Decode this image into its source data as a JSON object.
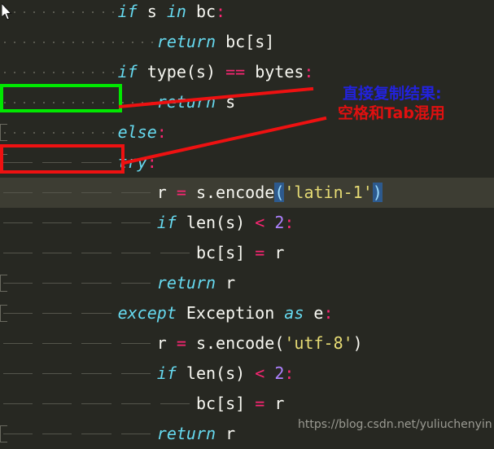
{
  "editor": {
    "background": "#272822",
    "current_line_background": "#3d3d33",
    "language": "python",
    "font_size_px": 20,
    "line_height_px": 37,
    "lines": [
      {
        "n": 1,
        "indent_kind": "spaces",
        "indent_units": 12,
        "text": "            if s in bc:",
        "tokens": [
          {
            "t": "if",
            "c": "kw"
          },
          {
            "t": " s ",
            "c": "id"
          },
          {
            "t": "in",
            "c": "kw"
          },
          {
            "t": " bc",
            "c": "id"
          },
          {
            "t": ":",
            "c": "op"
          }
        ]
      },
      {
        "n": 2,
        "indent_kind": "spaces",
        "indent_units": 16,
        "text": "                return bc[s]",
        "tokens": [
          {
            "t": "return",
            "c": "kw"
          },
          {
            "t": " bc[s]",
            "c": "id"
          }
        ]
      },
      {
        "n": 3,
        "indent_kind": "spaces",
        "indent_units": 12,
        "text": "            if type(s) == bytes:",
        "tokens": [
          {
            "t": "if",
            "c": "kw"
          },
          {
            "t": " type(s) ",
            "c": "id"
          },
          {
            "t": "==",
            "c": "op"
          },
          {
            "t": " bytes",
            "c": "id"
          },
          {
            "t": ":",
            "c": "op"
          }
        ]
      },
      {
        "n": 4,
        "indent_kind": "spaces",
        "indent_units": 16,
        "text": "                return s",
        "tokens": [
          {
            "t": "return",
            "c": "kw"
          },
          {
            "t": " s",
            "c": "id"
          }
        ]
      },
      {
        "n": 5,
        "indent_kind": "spaces",
        "indent_units": 12,
        "text": "            else:",
        "tokens": [
          {
            "t": "else",
            "c": "kw"
          },
          {
            "t": ":",
            "c": "op"
          }
        ]
      },
      {
        "n": 6,
        "indent_kind": "tabs",
        "indent_units": 3,
        "text": "\t\t\ttry:",
        "tokens": [
          {
            "t": "try",
            "c": "kw"
          },
          {
            "t": ":",
            "c": "op"
          }
        ]
      },
      {
        "n": 7,
        "indent_kind": "tabs",
        "indent_units": 4,
        "current": true,
        "text": "\t\t\t\tr = s.encode('latin-1')",
        "tokens": [
          {
            "t": "r ",
            "c": "id"
          },
          {
            "t": "=",
            "c": "op"
          },
          {
            "t": " s.encode",
            "c": "id"
          },
          {
            "t": "(",
            "c": "brkhl"
          },
          {
            "t": "'latin-1'",
            "c": "str"
          },
          {
            "t": ")",
            "c": "brkhl"
          }
        ]
      },
      {
        "n": 8,
        "indent_kind": "tabs",
        "indent_units": 4,
        "text": "\t\t\t\tif len(s) < 2:",
        "tokens": [
          {
            "t": "if",
            "c": "kw"
          },
          {
            "t": " len(s) ",
            "c": "id"
          },
          {
            "t": "<",
            "c": "op"
          },
          {
            "t": " ",
            "c": "id"
          },
          {
            "t": "2",
            "c": "num"
          },
          {
            "t": ":",
            "c": "op"
          }
        ]
      },
      {
        "n": 9,
        "indent_kind": "tabs",
        "indent_units": 5,
        "text": "\t\t\t\t\tbc[s] = r",
        "tokens": [
          {
            "t": "bc[s] ",
            "c": "id"
          },
          {
            "t": "=",
            "c": "op"
          },
          {
            "t": " r",
            "c": "id"
          }
        ]
      },
      {
        "n": 10,
        "indent_kind": "tabs",
        "indent_units": 4,
        "text": "\t\t\t\treturn r",
        "tokens": [
          {
            "t": "return",
            "c": "kw"
          },
          {
            "t": " r",
            "c": "id"
          }
        ]
      },
      {
        "n": 11,
        "indent_kind": "tabs",
        "indent_units": 3,
        "text": "\t\t\texcept Exception as e:",
        "tokens": [
          {
            "t": "except",
            "c": "kw"
          },
          {
            "t": " Exception ",
            "c": "id"
          },
          {
            "t": "as",
            "c": "kw"
          },
          {
            "t": " e",
            "c": "id"
          },
          {
            "t": ":",
            "c": "op"
          }
        ]
      },
      {
        "n": 12,
        "indent_kind": "tabs",
        "indent_units": 4,
        "text": "\t\t\t\tr = s.encode('utf-8')",
        "tokens": [
          {
            "t": "r ",
            "c": "id"
          },
          {
            "t": "=",
            "c": "op"
          },
          {
            "t": " s.encode",
            "c": "brk"
          },
          {
            "t": "(",
            "c": "brk"
          },
          {
            "t": "'utf-8'",
            "c": "str"
          },
          {
            "t": ")",
            "c": "brk"
          }
        ]
      },
      {
        "n": 13,
        "indent_kind": "tabs",
        "indent_units": 4,
        "text": "\t\t\t\tif len(s) < 2:",
        "tokens": [
          {
            "t": "if",
            "c": "kw"
          },
          {
            "t": " len(s) ",
            "c": "id"
          },
          {
            "t": "<",
            "c": "op"
          },
          {
            "t": " ",
            "c": "id"
          },
          {
            "t": "2",
            "c": "num"
          },
          {
            "t": ":",
            "c": "op"
          }
        ]
      },
      {
        "n": 14,
        "indent_kind": "tabs",
        "indent_units": 5,
        "text": "\t\t\t\t\tbc[s] = r",
        "tokens": [
          {
            "t": "bc[s] ",
            "c": "id"
          },
          {
            "t": "=",
            "c": "op"
          },
          {
            "t": " r",
            "c": "id"
          }
        ]
      },
      {
        "n": 15,
        "indent_kind": "tabs",
        "indent_units": 4,
        "text": "\t\t\t\treturn r",
        "tokens": [
          {
            "t": "return",
            "c": "kw"
          },
          {
            "t": " r",
            "c": "id"
          }
        ]
      }
    ]
  },
  "annotations": {
    "note_line1": "直接复制结果:",
    "note_line2": "空格和Tab混用",
    "note_line1_color": "#2222dd",
    "note_line2_color": "#e01010",
    "green_box_color": "#00e800",
    "red_box_color": "#ee1111",
    "green_box_meaning": "spaces-indent-highlight",
    "red_box_meaning": "tab-indent-highlight"
  },
  "watermark": {
    "text": "https://blog.csdn.net/yuliuchenyin"
  },
  "palette": {
    "keyword": "#66d9ef",
    "operator": "#f92672",
    "string": "#e6db74",
    "number": "#ae81ff",
    "identifier": "#f8f8f2",
    "bracket_match_bg": "#2d5a8e",
    "whitespace_dot": "#5a5a50",
    "tab_guide": "#55554c"
  }
}
